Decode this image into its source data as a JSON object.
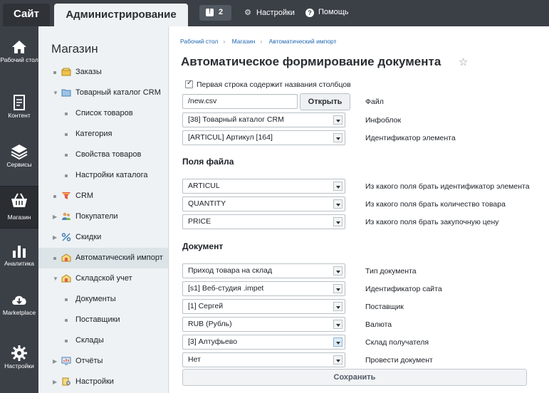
{
  "topbar": {
    "site_tab": "Сайт",
    "admin_tab": "Администрирование",
    "notifications_count": "2",
    "settings": "Настройки",
    "help": "Помощь"
  },
  "iconbar": {
    "items": [
      {
        "label": "Рабочий стол",
        "icon": "home-icon"
      },
      {
        "label": "Контент",
        "icon": "document-icon"
      },
      {
        "label": "Сервисы",
        "icon": "layers-icon"
      },
      {
        "label": "Магазин",
        "icon": "basket-icon"
      },
      {
        "label": "Аналитика",
        "icon": "bar-chart-icon"
      },
      {
        "label": "Marketplace",
        "icon": "cloud-download-icon"
      },
      {
        "label": "Настройки",
        "icon": "gear-icon"
      }
    ]
  },
  "menu": {
    "title": "Магазин",
    "items": [
      {
        "label": "Заказы"
      },
      {
        "label": "Товарный каталог CRM"
      },
      {
        "label": "Список товаров"
      },
      {
        "label": "Категория"
      },
      {
        "label": "Свойства товаров"
      },
      {
        "label": "Настройки каталога"
      },
      {
        "label": "CRM"
      },
      {
        "label": "Покупатели"
      },
      {
        "label": "Скидки"
      },
      {
        "label": "Автоматический импорт"
      },
      {
        "label": "Складской учет"
      },
      {
        "label": "Документы"
      },
      {
        "label": "Поставщики"
      },
      {
        "label": "Склады"
      },
      {
        "label": "Отчёты"
      },
      {
        "label": "Настройки"
      }
    ]
  },
  "main": {
    "breadcrumbs": [
      "Рабочий стол",
      "Магазин",
      "Автоматический импорт"
    ],
    "title": "Автоматическое формирование документа",
    "checkbox_label": "Первая строка содержит названия столбцов",
    "file_value": "/new.csv",
    "open_button": "Открыть",
    "labels": {
      "file": "Файл",
      "infoblock": "Инфоблок",
      "element_id": "Идентификатор элемента",
      "id_field": "Из какого поля брать идентификатор элемента",
      "qty_field": "Из какого поля брать количество товара",
      "price_field": "Из какого поля брать закупочную цену",
      "doc_type": "Тип документа",
      "site_id": "Идентификатор сайта",
      "supplier": "Поставщик",
      "currency": "Валюта",
      "warehouse": "Склад получателя",
      "post": "Провести документ"
    },
    "values": {
      "infoblock": "[38] Товарный каталог CRM",
      "element_id": "[ARTICUL] Артикул [164]",
      "id_field": "ARTICUL",
      "qty_field": "QUANTITY",
      "price_field": "PRICE",
      "doc_type": "Приход товара на склад",
      "site_id": "[s1] Веб-студия .impet",
      "supplier": "[1] Сергей",
      "currency": "RUB (Рубль)",
      "warehouse": "[3] Алтуфьево",
      "post": "Нет"
    },
    "section_file": "Поля файла",
    "section_doc": "Документ",
    "save_button": "Сохранить"
  }
}
